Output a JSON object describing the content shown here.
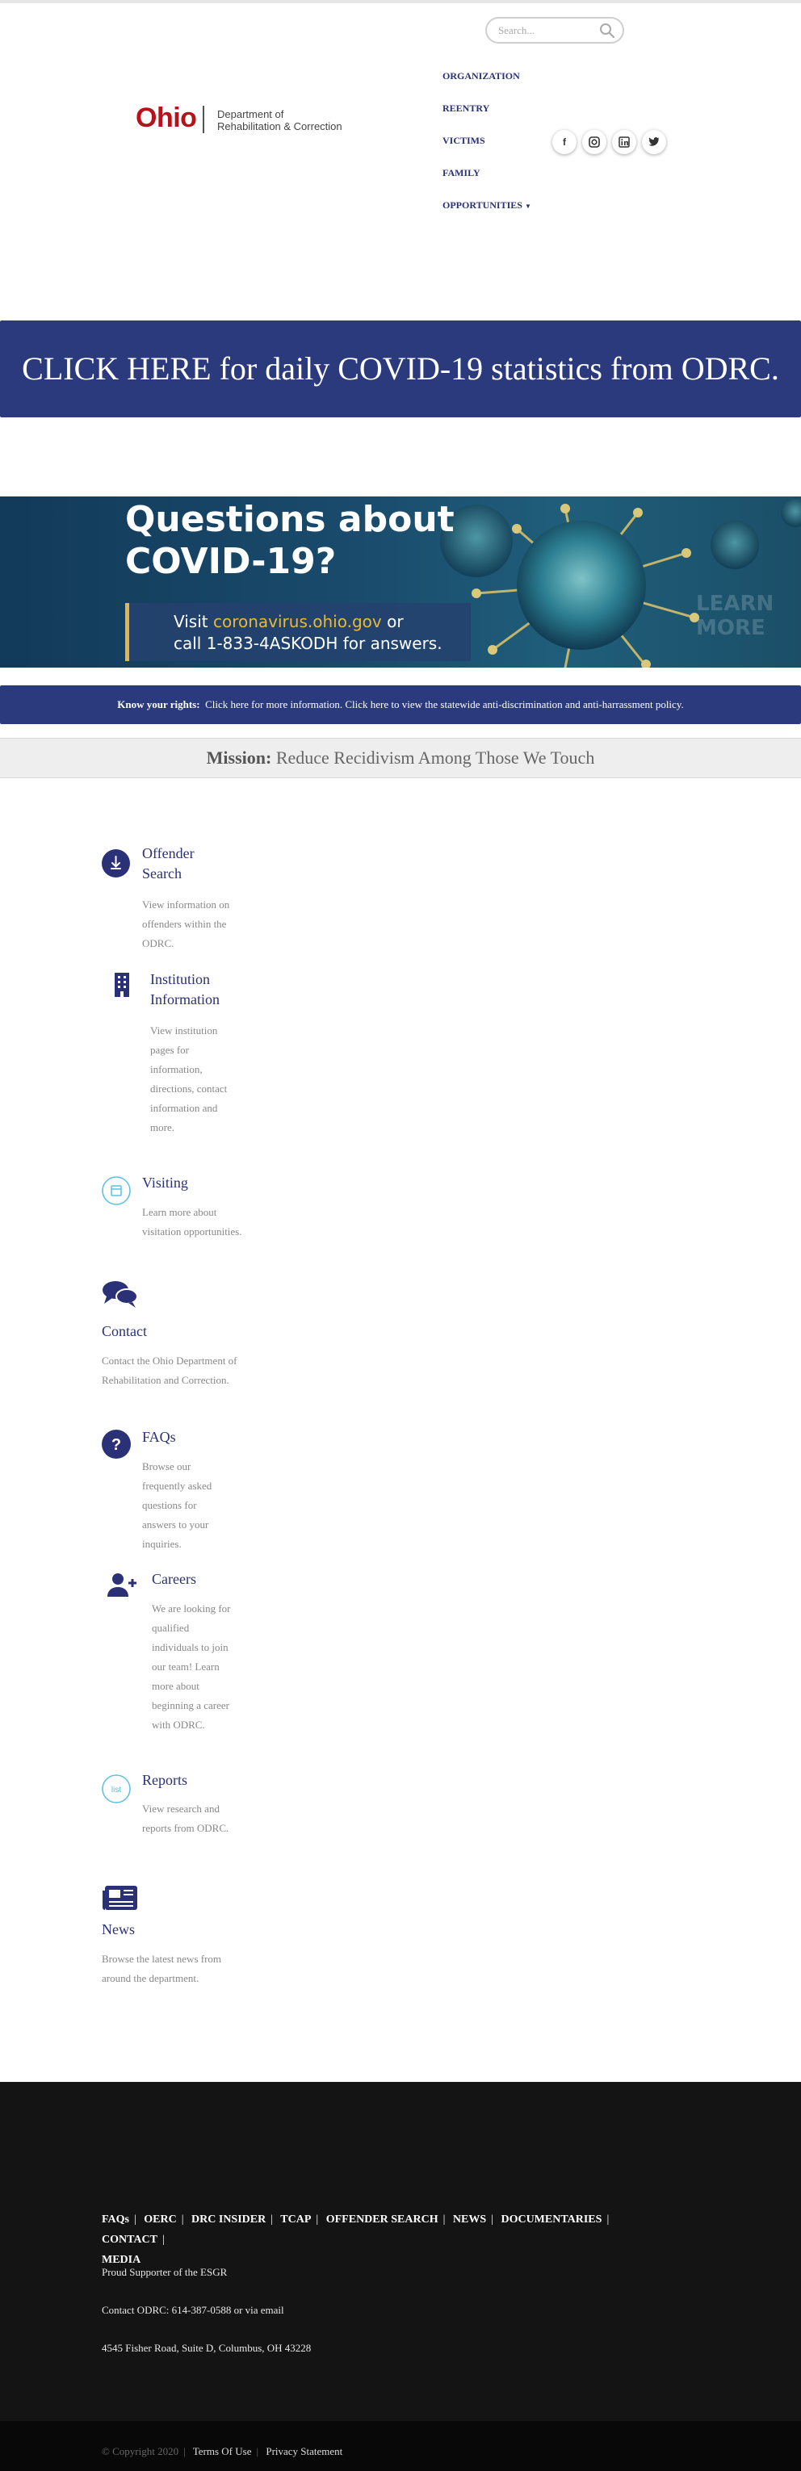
{
  "header": {
    "search_placeholder": "Search...",
    "logo": {
      "wordmark": "Ohio",
      "dept_line1": "Department of",
      "dept_line2": "Rehabilitation & Correction"
    },
    "nav": [
      "ORGANIZATION",
      "REENTRY",
      "VICTIMS",
      "FAMILY",
      "OPPORTUNITIES"
    ],
    "social": [
      "facebook-icon",
      "instagram-icon",
      "linkedin-icon",
      "twitter-icon"
    ]
  },
  "covid_banner": {
    "text": "CLICK HERE for daily COVID-19 statistics from ODRC."
  },
  "covid_image": {
    "headline_line1": "Questions about",
    "headline_line2": "COVID-19?",
    "visit": "Visit",
    "url": "coronavirus.ohio.gov",
    "or": "or",
    "call": "call 1-833-4ASKODH for answers.",
    "faint": "LEARN MORE"
  },
  "rights": {
    "label": "Know your rights:",
    "text": "Click here for more information. Click here to view the statewide anti-discrimination and anti-harrassment policy."
  },
  "mission": {
    "label": "Mission:",
    "text": "Reduce Recidivism Among Those We Touch"
  },
  "cards": [
    {
      "icon": "handcuffs-icon",
      "title": "Offender Search",
      "desc": "View information on offenders within the ODRC."
    },
    {
      "icon": "building-icon",
      "title": "Institution Information",
      "desc": "View institution pages for information, directions, contact information and more."
    },
    {
      "icon": "calendar-icon",
      "title": "Visiting",
      "desc": "Learn more about visitation opportunities."
    },
    {
      "icon": "chat-bubbles-icon",
      "title": "Contact",
      "desc": "Contact the Ohio Department of Rehabilitation and Correction."
    },
    {
      "icon": "question-icon",
      "title": "FAQs",
      "desc": "Browse our frequently asked questions for answers to your inquiries."
    },
    {
      "icon": "add-user-icon",
      "title": "Careers",
      "desc": "We are looking for qualified individuals to join our team! Learn more about beginning a career with ODRC."
    },
    {
      "icon": "list-icon",
      "title": "Reports",
      "desc": "View research and reports from ODRC."
    },
    {
      "icon": "newspaper-icon",
      "title": "News",
      "desc": "Browse the latest news from around the department."
    }
  ],
  "footer": {
    "links": [
      "FAQs",
      "OERC",
      "DRC INSIDER",
      "TCAP",
      "OFFENDER SEARCH",
      "NEWS",
      "DOCUMENTARIES",
      "CONTACT",
      "MEDIA"
    ],
    "esgr": "Proud Supporter of the ESGR",
    "contact": "Contact ODRC: 614-387-0588 or via email",
    "address": "4545 Fisher Road, Suite D, Columbus, OH 43228"
  },
  "bottom": {
    "copyright": "© Copyright 2020",
    "terms": "Terms Of Use",
    "privacy": "Privacy Statement"
  }
}
